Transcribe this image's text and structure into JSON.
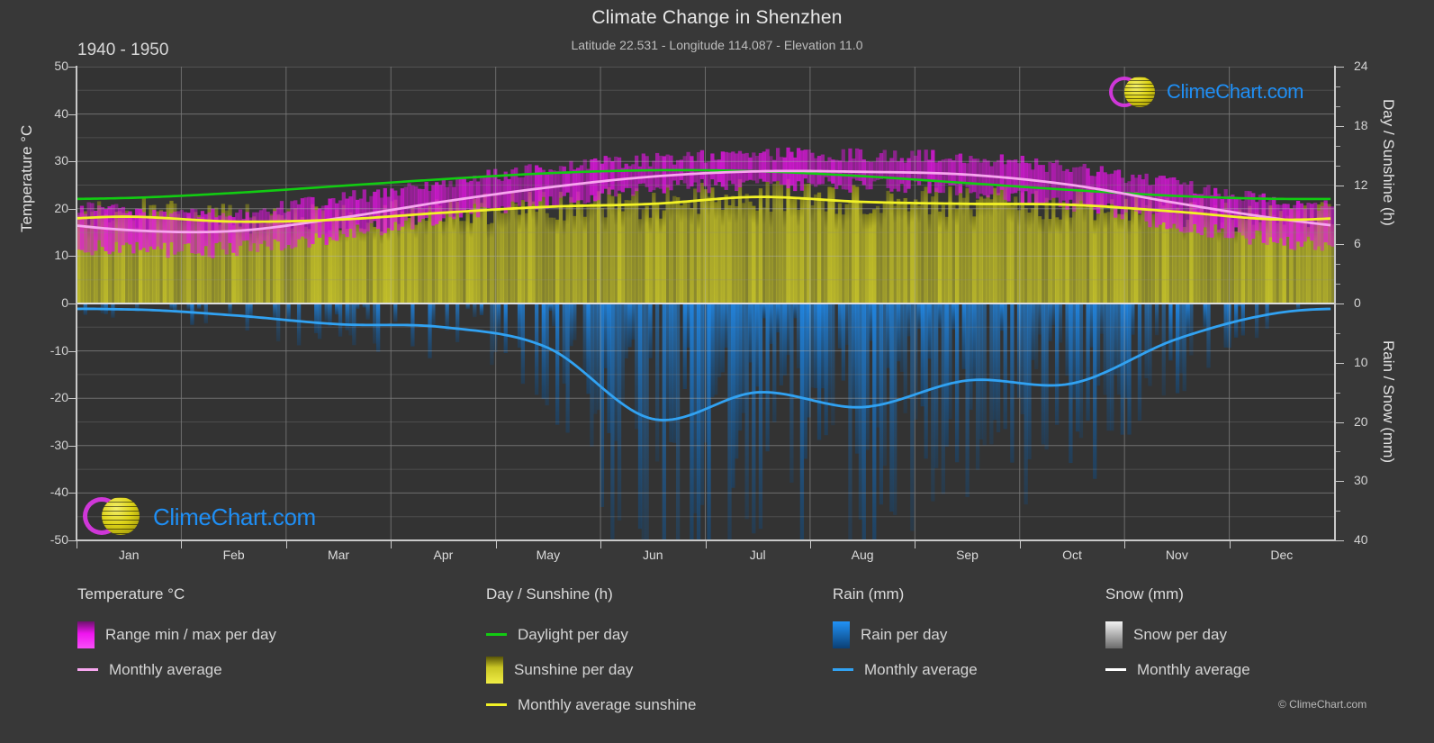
{
  "header": {
    "title": "Climate Change in Shenzhen",
    "subtitle": "Latitude 22.531 - Longitude 114.087 - Elevation 11.0",
    "period": "1940 - 1950"
  },
  "watermark": {
    "text": "ClimeChart.com"
  },
  "copyright": "© ClimeChart.com",
  "axes": {
    "left_title": "Temperature °C",
    "right_top_title": "Day / Sunshine (h)",
    "right_bottom_title": "Rain / Snow (mm)",
    "left_ticks": [
      "50",
      "40",
      "30",
      "20",
      "10",
      "0",
      "-10",
      "-20",
      "-30",
      "-40",
      "-50"
    ],
    "right_top_ticks": [
      "24",
      "18",
      "12",
      "6",
      "0"
    ],
    "right_bottom_ticks": [
      "0",
      "10",
      "20",
      "30",
      "40"
    ],
    "x_ticks": [
      "Jan",
      "Feb",
      "Mar",
      "Apr",
      "May",
      "Jun",
      "Jul",
      "Aug",
      "Sep",
      "Oct",
      "Nov",
      "Dec"
    ]
  },
  "colors": {
    "background": "#383838",
    "plot_background": "#333333",
    "grid": "#8d8d8d",
    "temp_range": "#e414e4",
    "temp_avg": "#f7a6ef",
    "daylight": "#12cc12",
    "sunshine_band": "#c8c526",
    "sunshine_avg": "#f2f226",
    "rain": "#1f8ff5",
    "rain_avg": "#31a2f2",
    "snow": "#e0e0e0",
    "snow_avg": "#ffffff",
    "text": "#d8d8d8"
  },
  "legend": {
    "columns": [
      {
        "title": "Temperature °C",
        "items": [
          {
            "label": "Range min / max per day",
            "swatch": "box",
            "swatch_name": "temp-range-swatch"
          },
          {
            "label": "Monthly average",
            "swatch": "line",
            "swatch_name": "temp-avg-swatch"
          }
        ]
      },
      {
        "title": "Day / Sunshine (h)",
        "items": [
          {
            "label": "Daylight per day",
            "swatch": "line",
            "swatch_name": "daylight-swatch"
          },
          {
            "label": "Sunshine per day",
            "swatch": "box",
            "swatch_name": "sunshine-swatch"
          },
          {
            "label": "Monthly average sunshine",
            "swatch": "line",
            "swatch_name": "sunshine-avg-swatch"
          }
        ]
      },
      {
        "title": "Rain (mm)",
        "items": [
          {
            "label": "Rain per day",
            "swatch": "box",
            "swatch_name": "rain-swatch"
          },
          {
            "label": "Monthly average",
            "swatch": "line",
            "swatch_name": "rain-avg-swatch"
          }
        ]
      },
      {
        "title": "Snow (mm)",
        "items": [
          {
            "label": "Snow per day",
            "swatch": "box",
            "swatch_name": "snow-swatch"
          },
          {
            "label": "Monthly average",
            "swatch": "line",
            "swatch_name": "snow-avg-swatch"
          }
        ]
      }
    ]
  },
  "chart_data": {
    "type": "area",
    "title": "Climate Change in Shenzhen",
    "subtitle": "Latitude 22.531 - Longitude 114.087 - Elevation 11.0",
    "period": "1940 - 1950",
    "xlabel": "",
    "ylabel": "Temperature °C",
    "ylabel_right_top": "Day / Sunshine (h)",
    "ylabel_right_bottom": "Rain / Snow (mm)",
    "ylim": [
      -50,
      50
    ],
    "ylim_right_top_h": [
      0,
      24
    ],
    "ylim_right_bottom_mm": [
      0,
      40
    ],
    "grid": true,
    "legend_position": "below",
    "categories": [
      "Jan",
      "Feb",
      "Mar",
      "Apr",
      "May",
      "Jun",
      "Jul",
      "Aug",
      "Sep",
      "Oct",
      "Nov",
      "Dec"
    ],
    "series": [
      {
        "name": "Monthly average temperature (°C)",
        "color": "#f7a6ef",
        "values": [
          15.5,
          15.3,
          18.0,
          21.5,
          24.5,
          26.8,
          27.9,
          27.8,
          27.2,
          25.0,
          21.2,
          17.8
        ]
      },
      {
        "name": "Daily max temperature (°C)",
        "color": "#e414e4",
        "values": [
          19.5,
          19.2,
          22.0,
          25.5,
          28.5,
          30.5,
          31.5,
          31.3,
          30.8,
          28.5,
          25.0,
          21.5
        ]
      },
      {
        "name": "Daily min temperature (°C)",
        "color": "#e414e4",
        "values": [
          11.5,
          11.5,
          14.5,
          18.5,
          21.5,
          24.0,
          25.0,
          25.0,
          24.0,
          21.0,
          16.5,
          13.0
        ]
      },
      {
        "name": "Daylight per day (h)",
        "color": "#12cc12",
        "values": [
          10.7,
          11.2,
          11.9,
          12.6,
          13.2,
          13.5,
          13.4,
          12.9,
          12.2,
          11.5,
          10.9,
          10.6
        ]
      },
      {
        "name": "Monthly average sunshine (h)",
        "color": "#f2f226",
        "values": [
          8.8,
          8.3,
          8.5,
          9.2,
          9.8,
          10.1,
          10.8,
          10.3,
          10.1,
          10.0,
          9.3,
          8.5
        ]
      },
      {
        "name": "Monthly average rain (mm)",
        "color": "#31a2f2",
        "values": [
          1.0,
          2.0,
          3.5,
          4.0,
          7.5,
          19.5,
          15.0,
          17.5,
          13.0,
          13.5,
          6.0,
          1.5
        ]
      },
      {
        "name": "Monthly average snow (mm)",
        "color": "#ffffff",
        "values": [
          0,
          0,
          0,
          0,
          0,
          0,
          0,
          0,
          0,
          0,
          0,
          0
        ]
      }
    ]
  }
}
